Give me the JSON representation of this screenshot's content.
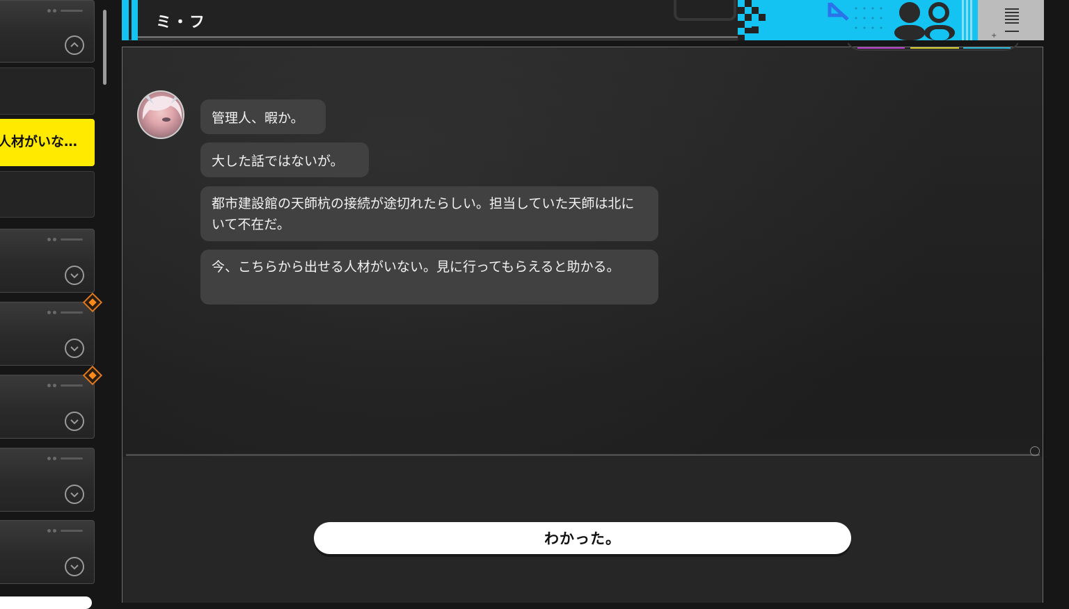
{
  "sidebar": {
    "active_item_label": "人材がいな…"
  },
  "chat": {
    "contact_name": "ミ・フ",
    "messages": [
      "管理人、暇か。",
      "大した話ではないが。",
      "都市建設館の天師杭の接続が途切れたらしい。担当していた天師は北にいて不在だ。",
      "今、こちらから出せる人材がいない。見に行ってもらえると助かる。"
    ],
    "reply_option": "わかった。"
  },
  "colors": {
    "accent_cyan": "#15c3f2",
    "active_yellow": "#ffea00",
    "badge_orange": "#ff8a1c",
    "bubble_bg": "#414141"
  }
}
